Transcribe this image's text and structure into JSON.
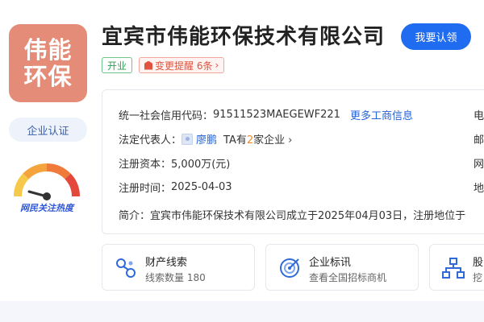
{
  "logo": {
    "line1": "伟能",
    "line2": "环保"
  },
  "certification": {
    "label": "企业认证"
  },
  "gauge": {
    "label": "网民关注热度"
  },
  "header": {
    "company_name": "宜宾市伟能环保技术有限公司",
    "claim_button": "我要认领",
    "status_tag": "开业",
    "change_tag": "变更提醒 6条",
    "change_tag_arrow": "›"
  },
  "info": {
    "credit_code_label": "统一社会信用代码：",
    "credit_code_value": "91511523MAEGEWF221",
    "more_link": "更多工商信息",
    "legal_rep_label": "法定代表人：",
    "legal_rep_name": "廖鹏",
    "legal_rep_text_prefix": "TA有",
    "legal_rep_count": "2",
    "legal_rep_text_suffix": "家企业",
    "legal_rep_arrow": "›",
    "capital_label": "注册资本：",
    "capital_value": "5,000万(元)",
    "reg_time_label": "注册时间：",
    "reg_time_value": "2025-04-03",
    "intro_label": "简介：",
    "intro_value": "宜宾市伟能环保技术有限公司成立于2025年04月03日，注册地位于",
    "right_col": [
      "电",
      "邮",
      "网",
      "地"
    ]
  },
  "cards": [
    {
      "title": "财产线索",
      "subtitle": "线索数量 180",
      "icon": "property-clue-icon"
    },
    {
      "title": "企业标讯",
      "subtitle": "查看全国招标商机",
      "icon": "bid-info-icon"
    },
    {
      "title": "股",
      "subtitle": "挖",
      "icon": "equity-icon"
    }
  ],
  "colors": {
    "brand_blue": "#1f6cf0",
    "logo_bg": "#e48c77",
    "status_green": "#2f9e52",
    "alert_red": "#e0533f",
    "accent_orange": "#f08a24"
  }
}
